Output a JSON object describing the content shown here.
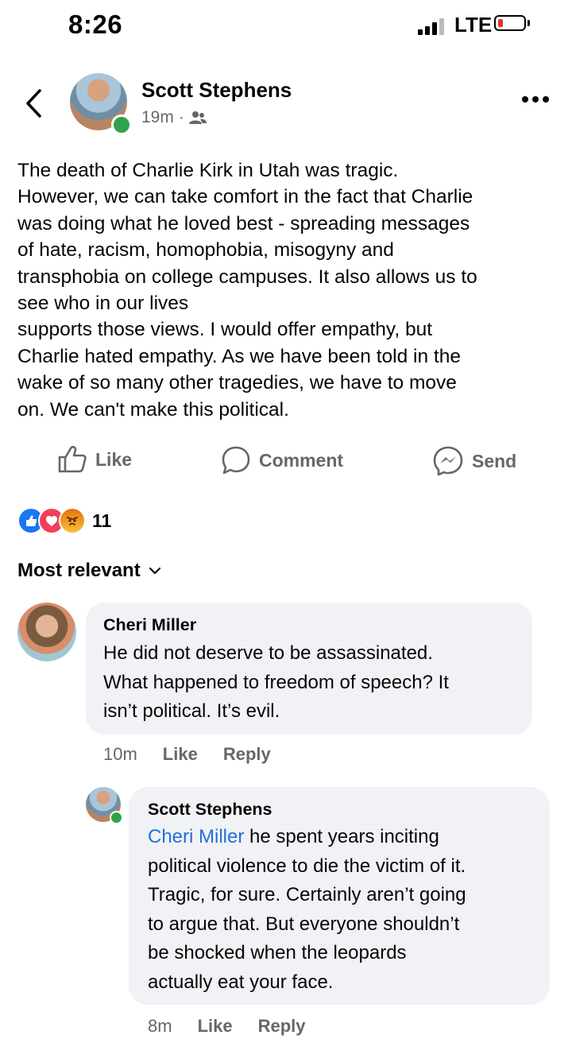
{
  "status_bar": {
    "time": "8:26",
    "network": "LTE"
  },
  "post": {
    "author": "Scott Stephens",
    "time_ago": "19m",
    "separator": "·",
    "audience_icon": "friends-icon",
    "body": "The death of Charlie Kirk in Utah was tragic.\nHowever, we can take comfort in the fact that Charlie\nwas doing what he loved best - spreading messages\nof hate, racism, homophobia, misogyny and\ntransphobia on college campuses. It also allows us to\nsee who in our lives\nsupports those views. I would offer empathy, but\nCharlie hated empathy. As we have been told in the\nwake of so many other tragedies, we have to move\non. We can't make this political."
  },
  "actions": {
    "like": "Like",
    "comment": "Comment",
    "send": "Send"
  },
  "reactions": {
    "count": "11",
    "types": [
      "like",
      "love",
      "angry"
    ]
  },
  "sort": {
    "label": "Most relevant"
  },
  "comments": [
    {
      "author": "Cheri Miller",
      "text": "He did not deserve to be assassinated.\nWhat happened to freedom of speech? It\nisn’t political. It’s evil.",
      "time_ago": "10m",
      "like": "Like",
      "reply": "Reply"
    },
    {
      "author": "Scott Stephens",
      "mention": "Cheri Miller",
      "text_after_mention": " he spent years inciting\npolitical violence to die the victim of it.\nTragic, for sure. Certainly aren’t going\nto argue that. But everyone shouldn’t\nbe shocked when the leopards\nactually eat your face.",
      "time_ago": "8m",
      "like": "Like",
      "reply": "Reply"
    }
  ],
  "colors": {
    "link": "#216fdb",
    "online": "#31a24c",
    "secondary_text": "#65676b",
    "bubble": "#f0f2f5"
  }
}
